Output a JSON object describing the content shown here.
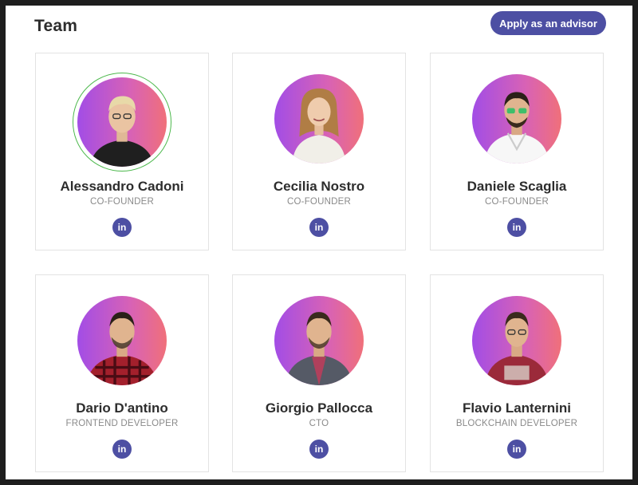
{
  "header": {
    "title": "Team",
    "apply_label": "Apply as an advisor"
  },
  "colors": {
    "accent": "#4d4fa3",
    "avatar_gradient_start": "#a24de6",
    "avatar_gradient_end": "#f0707a",
    "ring": "#4cb84c"
  },
  "members": [
    {
      "name": "Alessandro Cadoni",
      "role": "CO-FOUNDER",
      "linkedin_label": "in",
      "shirt": "#1f1f1f",
      "hair": "#e8d9a8"
    },
    {
      "name": "Cecilia Nostro",
      "role": "CO-FOUNDER",
      "linkedin_label": "in",
      "shirt": "#f1efe8",
      "hair": "#b07d45"
    },
    {
      "name": "Daniele Scaglia",
      "role": "CO-FOUNDER",
      "linkedin_label": "in",
      "shirt": "#f7f7f7",
      "hair": "#2a2018"
    },
    {
      "name": "Dario D'antino",
      "role": "FRONTEND DEVELOPER",
      "linkedin_label": "in",
      "shirt": "#a3202c",
      "hair": "#2a2018"
    },
    {
      "name": "Giorgio Pallocca",
      "role": "CTO",
      "linkedin_label": "in",
      "shirt": "#555a66",
      "hair": "#3a2a1c"
    },
    {
      "name": "Flavio Lanternini",
      "role": "BLOCKCHAIN DEVELOPER",
      "linkedin_label": "in",
      "shirt": "#9b2a3a",
      "hair": "#3a2a1c"
    }
  ]
}
